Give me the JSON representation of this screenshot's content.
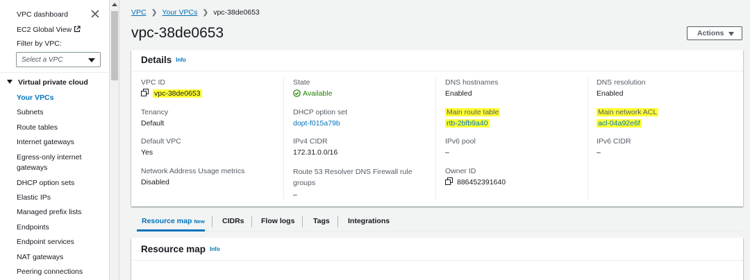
{
  "sidebar": {
    "dashboard": "VPC dashboard",
    "ec2_global": "EC2 Global View",
    "filter_label": "Filter by VPC:",
    "filter_placeholder": "Select a VPC",
    "section": "Virtual private cloud",
    "items": [
      {
        "label": "Your VPCs",
        "active": true
      },
      {
        "label": "Subnets"
      },
      {
        "label": "Route tables"
      },
      {
        "label": "Internet gateways"
      },
      {
        "label": "Egress-only internet gateways"
      },
      {
        "label": "DHCP option sets"
      },
      {
        "label": "Elastic IPs"
      },
      {
        "label": "Managed prefix lists"
      },
      {
        "label": "Endpoints"
      },
      {
        "label": "Endpoint services"
      },
      {
        "label": "NAT gateways"
      },
      {
        "label": "Peering connections"
      }
    ]
  },
  "breadcrumb": {
    "vpc": "VPC",
    "your_vpcs": "Your VPCs",
    "current": "vpc-38de0653"
  },
  "page": {
    "title": "vpc-38de0653",
    "actions": "Actions"
  },
  "details": {
    "title": "Details",
    "info": "Info",
    "vpc_id": {
      "label": "VPC ID",
      "value": "vpc-38de0653"
    },
    "state": {
      "label": "State",
      "value": "Available"
    },
    "dns_hostnames": {
      "label": "DNS hostnames",
      "value": "Enabled"
    },
    "dns_resolution": {
      "label": "DNS resolution",
      "value": "Enabled"
    },
    "tenancy": {
      "label": "Tenancy",
      "value": "Default"
    },
    "dhcp": {
      "label": "DHCP option set",
      "value": "dopt-f015a79b"
    },
    "main_route_table": {
      "label": "Main route table",
      "value": "rtb-2bfb9a40"
    },
    "main_acl": {
      "label": "Main network ACL",
      "value": "acl-04a92e6f"
    },
    "default_vpc": {
      "label": "Default VPC",
      "value": "Yes"
    },
    "ipv4_cidr": {
      "label": "IPv4 CIDR",
      "value": "172.31.0.0/16"
    },
    "ipv6_pool": {
      "label": "IPv6 pool",
      "value": "–"
    },
    "ipv6_cidr": {
      "label": "IPv6 CIDR",
      "value": "–"
    },
    "nau": {
      "label": "Network Address Usage metrics",
      "value": "Disabled"
    },
    "route53": {
      "label": "Route 53 Resolver DNS Firewall rule groups",
      "value": "–"
    },
    "owner_id": {
      "label": "Owner ID",
      "value": "886452391640"
    }
  },
  "tabs": {
    "resource_map": "Resource map",
    "new_badge": "New",
    "cidrs": "CIDRs",
    "flow_logs": "Flow logs",
    "tags": "Tags",
    "integrations": "Integrations"
  },
  "resource_map": {
    "title": "Resource map",
    "info": "Info"
  },
  "colors": {
    "link": "#0073bb",
    "highlight": "#ffff33",
    "available": "#1d8102"
  }
}
